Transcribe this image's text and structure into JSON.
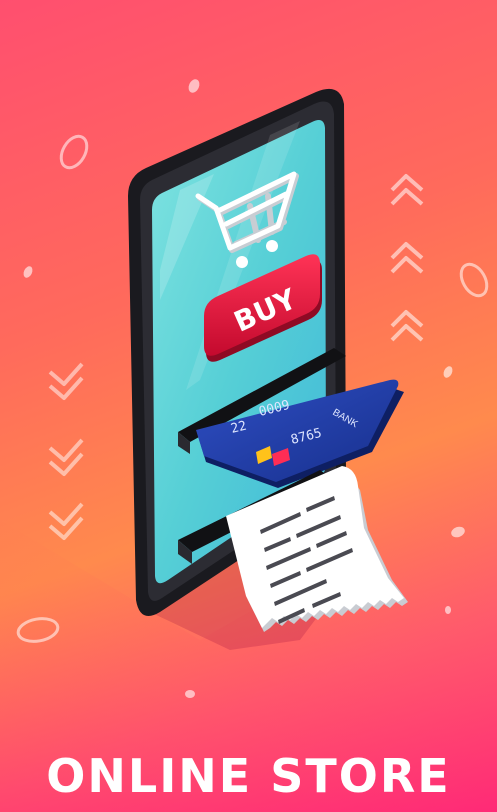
{
  "poster": {
    "title": "ONLINE STORE"
  },
  "phone": {
    "buy_button_label": "BUY"
  },
  "card": {
    "number_part_1": "0009",
    "number_part_2": "8765",
    "number_part_3": "22",
    "bank_label": "BANK"
  },
  "icons": [
    "cart-icon",
    "card-logo-icon",
    "chevron-icon",
    "ring-icon",
    "dot-icon"
  ],
  "colors": {
    "background_top": "#ff4f6f",
    "background_mid": "#ff8a4d",
    "background_bottom": "#ff2f7a",
    "screen": "#5fd6d6",
    "buy_button": "#e8123d",
    "card": "#1f3a9e",
    "receipt": "#ffffff"
  }
}
